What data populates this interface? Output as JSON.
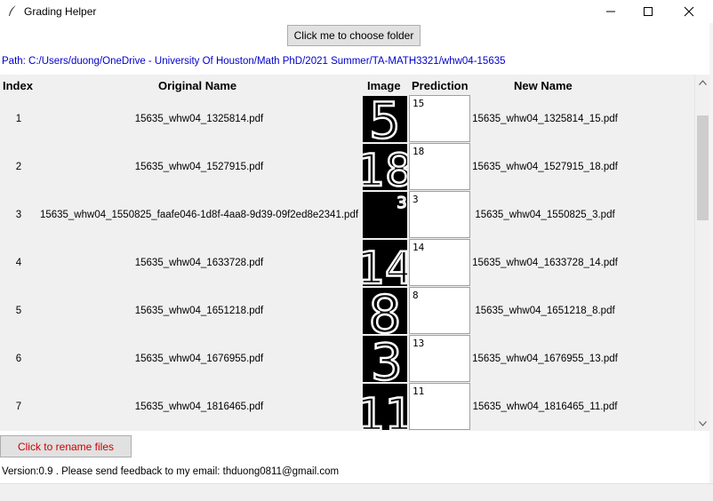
{
  "window": {
    "title": "Grading Helper"
  },
  "toolbar": {
    "choose_folder_label": "Click me to choose folder"
  },
  "path_text": "Path: C:/Users/duong/OneDrive - University Of Houston/Math PhD/2021 Summer/TA-MATH3321/whw04-15635",
  "table": {
    "headers": {
      "index": "Index",
      "original": "Original Name",
      "image": "Image",
      "prediction": "Prediction",
      "new": "New Name"
    },
    "rows": [
      {
        "index": "1",
        "original": "15635_whw04_1325814.pdf",
        "prediction": "15",
        "new": "15635_whw04_1325814_15.pdf",
        "digits": "5"
      },
      {
        "index": "2",
        "original": "15635_whw04_1527915.pdf",
        "prediction": "18",
        "new": "15635_whw04_1527915_18.pdf",
        "digits": "18"
      },
      {
        "index": "3",
        "original": "15635_whw04_1550825_faafe046-1d8f-4aa8-9d39-09f2ed8e2341.pdf",
        "prediction": "3",
        "new": "15635_whw04_1550825_3.pdf",
        "digits": "3"
      },
      {
        "index": "4",
        "original": "15635_whw04_1633728.pdf",
        "prediction": "14",
        "new": "15635_whw04_1633728_14.pdf",
        "digits": "14"
      },
      {
        "index": "5",
        "original": "15635_whw04_1651218.pdf",
        "prediction": "8",
        "new": "15635_whw04_1651218_8.pdf",
        "digits": "8"
      },
      {
        "index": "6",
        "original": "15635_whw04_1676955.pdf",
        "prediction": "13",
        "new": "15635_whw04_1676955_13.pdf",
        "digits": "3"
      },
      {
        "index": "7",
        "original": "15635_whw04_1816465.pdf",
        "prediction": "11",
        "new": "15635_whw04_1816465_11.pdf",
        "digits": "11"
      }
    ]
  },
  "rename_label": "Click to rename files",
  "version_text": "Version:0.9 . Please send feedback to my email: thduong0811@gmail.com",
  "colors": {
    "path": "#0000cc",
    "rename_text": "#cc0000",
    "panel": "#f0f0f0"
  },
  "icons": {
    "app": "feather-icon",
    "minimize": "minimize-icon",
    "maximize": "maximize-icon",
    "close": "close-icon"
  }
}
